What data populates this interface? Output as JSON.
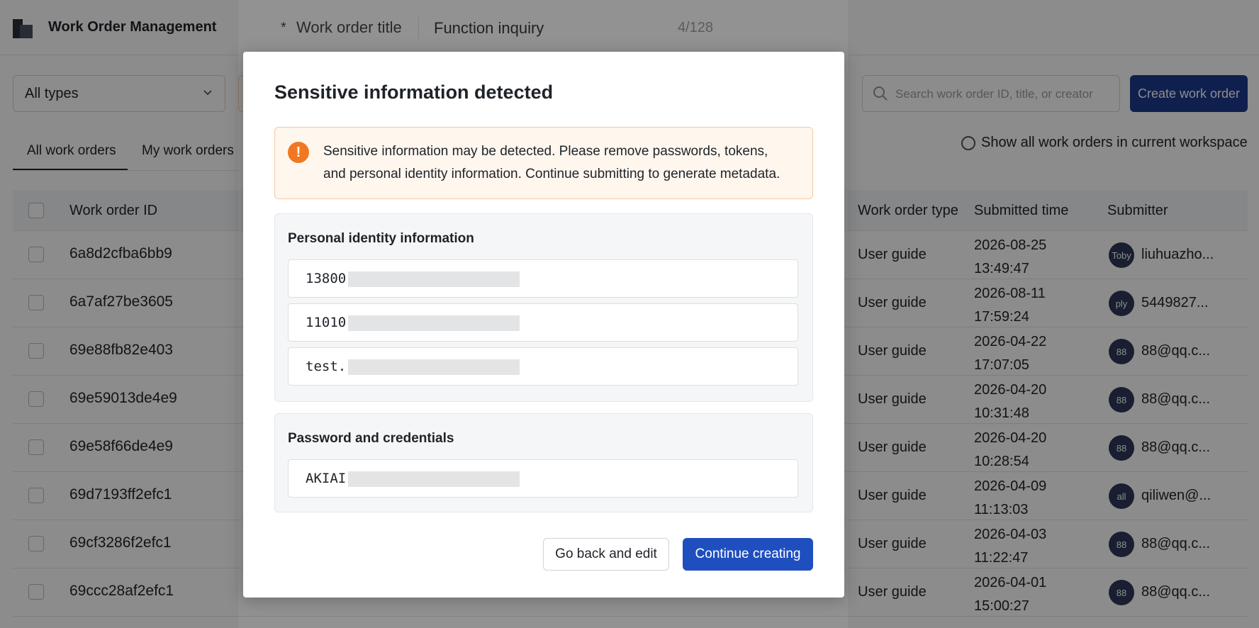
{
  "app": {
    "title": "Work Order Management"
  },
  "form_header": {
    "required_mark": "*",
    "title_label": "Work order title",
    "title_value": "Function inquiry",
    "char_count": "4/128"
  },
  "filters": {
    "type_select": "All types",
    "search_placeholder": "Search work order ID, title, or creator",
    "create_button": "Create work order"
  },
  "tabs": [
    {
      "label": "All work orders",
      "active": true
    },
    {
      "label": "My work orders",
      "active": false
    }
  ],
  "workspace_toggle": "Show all work orders in current workspace",
  "table": {
    "columns": [
      "Work order ID",
      "Work order type",
      "Submitted time",
      "Submitter"
    ],
    "rows": [
      {
        "id": "6a8d2cfba6bb9",
        "type": "User guide",
        "time": "2026-08-25 13:49:47",
        "avatar": "Toby",
        "submitter": "liuhuazho..."
      },
      {
        "id": "6a7af27be3605",
        "type": "User guide",
        "time": "2026-08-11 17:59:24",
        "avatar": "ply",
        "submitter": "5449827..."
      },
      {
        "id": "69e88fb82e403",
        "type": "User guide",
        "time": "2026-04-22 17:07:05",
        "avatar": "88",
        "submitter": "88@qq.c..."
      },
      {
        "id": "69e59013de4e9",
        "type": "User guide",
        "time": "2026-04-20 10:31:48",
        "avatar": "88",
        "submitter": "88@qq.c..."
      },
      {
        "id": "69e58f66de4e9",
        "type": "User guide",
        "time": "2026-04-20 10:28:54",
        "avatar": "88",
        "submitter": "88@qq.c..."
      },
      {
        "id": "69d7193ff2efc1",
        "type": "User guide",
        "time": "2026-04-09 11:13:03",
        "avatar": "all",
        "submitter": "qiliwen@..."
      },
      {
        "id": "69cf3286f2efc1",
        "type": "User guide",
        "time": "2026-04-03 11:22:47",
        "avatar": "88",
        "submitter": "88@qq.c..."
      },
      {
        "id": "69ccc28af2efc1",
        "type": "User guide",
        "time": "2026-04-01 15:00:27",
        "avatar": "88",
        "submitter": "88@qq.c..."
      }
    ]
  },
  "modal": {
    "title": "Sensitive information detected",
    "alert_icon": "exclamation-icon",
    "alert_text": "Sensitive information may be detected. Please remove passwords, tokens, and personal identity information. Continue submitting to generate metadata.",
    "sections": [
      {
        "title": "Personal identity information",
        "fields": [
          "13800",
          "11010",
          "test."
        ]
      },
      {
        "title": "Password and credentials",
        "fields": [
          "AKIAI"
        ]
      }
    ],
    "back_button": "Go back and edit",
    "continue_button": "Continue creating"
  },
  "colors": {
    "primary": "#1f4fbf",
    "dark_primary": "#1d3b8f",
    "warning": "#f07823",
    "warning_bg": "#fff6ee"
  }
}
